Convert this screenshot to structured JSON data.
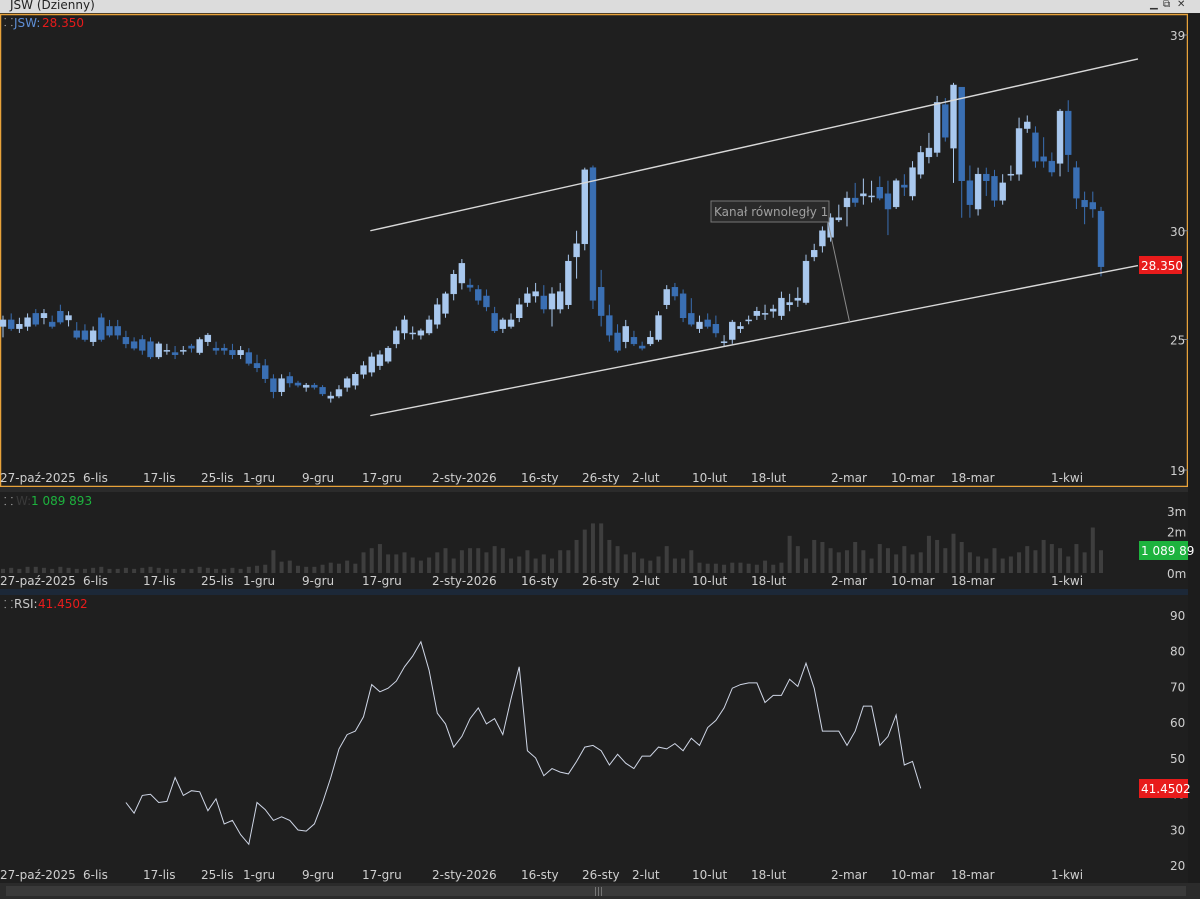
{
  "window": {
    "title": "JSW (Dzienny)",
    "min_icon": "minimize-icon",
    "restore_icon": "restore-icon",
    "close_icon": "close-icon"
  },
  "colors": {
    "background": "#1f1f1f",
    "border_accent": "#e8a23a",
    "bull": "#a9c8ee",
    "bear": "#3a6fb3",
    "price_badge": "#e81b1b",
    "volume_badge": "#1db33e",
    "line": "#d8d8d8",
    "volume_bar": "#3e3e3e"
  },
  "panels": {
    "price": {
      "label": "JSW:",
      "value": "28.350",
      "badge": "28.350",
      "yaxis_ticks": [
        "39",
        "30",
        "25",
        "19"
      ]
    },
    "volume": {
      "label": "W:",
      "value": "1 089 893",
      "badge": "1 089 89",
      "yaxis_ticks": [
        "3m",
        "2m",
        "1m",
        "0m"
      ]
    },
    "rsi": {
      "label": "RSI:",
      "value": "41.4502",
      "badge": "41.4502",
      "yaxis_ticks": [
        "90",
        "80",
        "70",
        "60",
        "50",
        "40",
        "30",
        "20"
      ]
    }
  },
  "annotation": {
    "text": "Kanał równoległy 1"
  },
  "x_labels": [
    "27-paź-2025",
    "6-lis",
    "17-lis",
    "25-lis",
    "1-gru",
    "9-gru",
    "17-gru",
    "2-sty-2026",
    "16-sty",
    "26-sty",
    "2-lut",
    "10-lut",
    "18-lut",
    "2-mar",
    "10-mar",
    "18-mar",
    "1-kwi"
  ],
  "chart_data": [
    {
      "type": "candlestick",
      "series_name": "JSW",
      "ylim": [
        19,
        40
      ],
      "ohlc": [
        [
          25.6,
          26.1,
          25.1,
          25.9
        ],
        [
          25.9,
          26.2,
          25.4,
          25.5
        ],
        [
          25.5,
          26.0,
          25.3,
          25.7
        ],
        [
          25.6,
          26.2,
          25.4,
          26.0
        ],
        [
          26.2,
          26.4,
          25.6,
          25.7
        ],
        [
          26.0,
          26.4,
          25.7,
          26.2
        ],
        [
          25.8,
          26.1,
          25.5,
          25.6
        ],
        [
          26.3,
          26.6,
          25.7,
          25.8
        ],
        [
          25.9,
          26.3,
          25.6,
          26.1
        ],
        [
          25.4,
          25.8,
          25.0,
          25.1
        ],
        [
          25.4,
          25.7,
          24.9,
          25.0
        ],
        [
          24.9,
          25.6,
          24.7,
          25.4
        ],
        [
          26.0,
          26.2,
          24.9,
          25.0
        ],
        [
          25.6,
          25.9,
          25.1,
          25.2
        ],
        [
          25.6,
          25.9,
          25.0,
          25.2
        ],
        [
          25.1,
          25.4,
          24.6,
          24.8
        ],
        [
          24.9,
          25.1,
          24.5,
          24.6
        ],
        [
          25.0,
          25.2,
          24.3,
          24.5
        ],
        [
          24.9,
          25.1,
          24.1,
          24.2
        ],
        [
          24.2,
          24.9,
          24.1,
          24.8
        ],
        [
          24.5,
          24.8,
          24.3,
          24.5
        ],
        [
          24.4,
          24.7,
          24.1,
          24.3
        ],
        [
          24.5,
          24.7,
          24.3,
          24.5
        ],
        [
          24.7,
          24.8,
          24.4,
          24.6
        ],
        [
          24.4,
          25.1,
          24.3,
          25.0
        ],
        [
          24.9,
          25.3,
          24.7,
          25.2
        ],
        [
          24.6,
          24.9,
          24.3,
          24.5
        ],
        [
          24.6,
          24.8,
          24.3,
          24.5
        ],
        [
          24.5,
          24.8,
          24.1,
          24.3
        ],
        [
          24.3,
          24.7,
          24.1,
          24.5
        ],
        [
          24.4,
          24.6,
          23.8,
          23.9
        ],
        [
          23.9,
          24.3,
          23.5,
          23.7
        ],
        [
          23.8,
          24.1,
          23.0,
          23.2
        ],
        [
          23.2,
          23.4,
          22.3,
          22.6
        ],
        [
          22.6,
          23.4,
          22.4,
          23.2
        ],
        [
          23.3,
          23.5,
          22.8,
          23.0
        ],
        [
          23.0,
          23.1,
          22.8,
          22.9
        ],
        [
          22.8,
          23.0,
          22.6,
          22.9
        ],
        [
          22.9,
          23.0,
          22.7,
          22.8
        ],
        [
          22.8,
          22.9,
          22.4,
          22.5
        ],
        [
          22.3,
          22.6,
          22.1,
          22.4
        ],
        [
          22.4,
          22.9,
          22.3,
          22.7
        ],
        [
          22.8,
          23.3,
          22.6,
          23.2
        ],
        [
          22.9,
          23.5,
          22.7,
          23.4
        ],
        [
          23.4,
          24.0,
          23.2,
          23.8
        ],
        [
          23.5,
          24.4,
          23.3,
          24.2
        ],
        [
          23.8,
          24.5,
          23.6,
          24.3
        ],
        [
          24.0,
          24.7,
          23.9,
          24.6
        ],
        [
          24.8,
          25.6,
          24.6,
          25.4
        ],
        [
          25.3,
          26.1,
          25.0,
          25.9
        ],
        [
          25.3,
          25.6,
          25.0,
          25.3
        ],
        [
          25.2,
          25.5,
          25.0,
          25.4
        ],
        [
          25.3,
          26.1,
          25.2,
          25.9
        ],
        [
          25.7,
          26.9,
          25.5,
          26.6
        ],
        [
          26.2,
          27.2,
          26.0,
          27.1
        ],
        [
          27.1,
          28.2,
          26.8,
          28.0
        ],
        [
          27.6,
          28.7,
          27.3,
          28.5
        ],
        [
          27.5,
          27.8,
          27.2,
          27.4
        ],
        [
          27.3,
          27.5,
          26.6,
          26.8
        ],
        [
          27.0,
          27.3,
          26.3,
          26.5
        ],
        [
          26.2,
          26.5,
          25.3,
          25.4
        ],
        [
          25.5,
          26.0,
          25.3,
          25.9
        ],
        [
          25.6,
          26.2,
          25.5,
          25.9
        ],
        [
          26.0,
          26.9,
          25.8,
          26.6
        ],
        [
          26.7,
          27.4,
          26.5,
          27.1
        ],
        [
          27.0,
          27.6,
          26.7,
          27.2
        ],
        [
          27.0,
          27.5,
          26.2,
          26.4
        ],
        [
          26.4,
          27.4,
          25.6,
          27.1
        ],
        [
          26.4,
          27.6,
          26.2,
          27.2
        ],
        [
          26.6,
          28.9,
          26.4,
          28.6
        ],
        [
          28.8,
          30.0,
          27.8,
          29.4
        ],
        [
          29.4,
          32.9,
          29.1,
          32.8
        ],
        [
          32.9,
          33.0,
          26.4,
          26.8
        ],
        [
          27.4,
          28.2,
          25.6,
          26.1
        ],
        [
          26.1,
          26.6,
          24.9,
          25.2
        ],
        [
          25.3,
          25.7,
          24.4,
          24.5
        ],
        [
          24.9,
          25.9,
          24.6,
          25.6
        ],
        [
          25.1,
          25.4,
          24.7,
          24.8
        ],
        [
          24.7,
          24.9,
          24.5,
          24.6
        ],
        [
          24.8,
          25.4,
          24.7,
          25.1
        ],
        [
          25.0,
          26.3,
          24.9,
          26.1
        ],
        [
          26.6,
          27.5,
          26.4,
          27.3
        ],
        [
          27.4,
          27.6,
          26.8,
          27.0
        ],
        [
          27.1,
          27.3,
          25.8,
          26.0
        ],
        [
          26.2,
          26.9,
          25.6,
          25.7
        ],
        [
          25.5,
          26.1,
          25.3,
          25.8
        ],
        [
          25.9,
          26.2,
          25.5,
          25.6
        ],
        [
          25.7,
          26.1,
          25.1,
          25.3
        ],
        [
          24.9,
          25.2,
          24.7,
          24.9
        ],
        [
          25.0,
          25.9,
          24.8,
          25.8
        ],
        [
          25.5,
          25.8,
          25.3,
          25.6
        ],
        [
          25.9,
          26.1,
          25.7,
          25.9
        ],
        [
          26.1,
          26.5,
          25.9,
          26.3
        ],
        [
          26.2,
          26.6,
          25.9,
          26.2
        ],
        [
          26.3,
          26.6,
          26.0,
          26.4
        ],
        [
          26.1,
          27.2,
          25.9,
          26.9
        ],
        [
          26.6,
          27.1,
          26.3,
          26.7
        ],
        [
          26.8,
          27.4,
          26.5,
          26.9
        ],
        [
          26.7,
          28.9,
          26.6,
          28.6
        ],
        [
          28.8,
          29.4,
          28.6,
          29.1
        ],
        [
          29.3,
          30.2,
          29.0,
          30.0
        ],
        [
          29.7,
          30.8,
          29.5,
          30.6
        ],
        [
          30.5,
          31.2,
          30.4,
          30.6
        ],
        [
          31.1,
          31.8,
          30.2,
          31.5
        ],
        [
          31.5,
          32.2,
          31.1,
          31.3
        ],
        [
          31.6,
          32.4,
          31.2,
          31.7
        ],
        [
          31.6,
          32.3,
          31.3,
          31.6
        ],
        [
          32.0,
          32.5,
          31.4,
          31.5
        ],
        [
          31.7,
          32.3,
          29.8,
          31.0
        ],
        [
          31.1,
          32.4,
          31.0,
          32.3
        ],
        [
          32.1,
          32.6,
          31.6,
          32.0
        ],
        [
          31.6,
          33.2,
          31.4,
          32.9
        ],
        [
          32.6,
          33.9,
          32.4,
          33.6
        ],
        [
          33.4,
          34.5,
          33.1,
          33.8
        ],
        [
          33.6,
          36.2,
          33.4,
          35.9
        ],
        [
          35.8,
          36.1,
          34.1,
          34.3
        ],
        [
          33.8,
          36.8,
          32.2,
          36.7
        ],
        [
          36.6,
          36.6,
          30.6,
          32.3
        ],
        [
          32.3,
          33.0,
          30.6,
          31.2
        ],
        [
          31.0,
          32.9,
          30.7,
          32.6
        ],
        [
          32.6,
          32.9,
          31.6,
          32.3
        ],
        [
          32.5,
          32.8,
          31.1,
          31.4
        ],
        [
          31.4,
          32.6,
          31.2,
          32.2
        ],
        [
          32.6,
          33.0,
          32.3,
          32.6
        ],
        [
          32.6,
          35.2,
          32.3,
          34.7
        ],
        [
          34.7,
          35.3,
          34.5,
          35.0
        ],
        [
          34.5,
          34.8,
          32.9,
          33.2
        ],
        [
          33.4,
          34.3,
          32.9,
          33.2
        ],
        [
          33.2,
          33.6,
          32.5,
          32.7
        ],
        [
          33.1,
          35.6,
          32.5,
          35.5
        ],
        [
          35.5,
          36.0,
          32.7,
          33.5
        ],
        [
          32.9,
          33.2,
          31.0,
          31.5
        ],
        [
          31.4,
          31.8,
          30.3,
          31.1
        ],
        [
          31.3,
          31.8,
          30.6,
          31.0
        ],
        [
          30.9,
          31.1,
          27.9,
          28.35
        ]
      ],
      "lines": [
        {
          "name": "channel-upper",
          "x": [
            0.3086,
            0.9483
          ],
          "y": [
            30.0,
            37.9
          ]
        },
        {
          "name": "channel-lower",
          "x": [
            0.3086,
            0.9483
          ],
          "y": [
            21.5,
            28.4
          ]
        },
        {
          "name": "annotation-leader",
          "x": [
            0.688,
            0.708
          ],
          "y": [
            30.9,
            25.8
          ]
        }
      ]
    },
    {
      "type": "bar",
      "series_name": "W",
      "ylim": [
        0,
        3.0
      ],
      "unit": "m",
      "values": [
        0.2,
        0.25,
        0.2,
        0.3,
        0.3,
        0.25,
        0.2,
        0.3,
        0.25,
        0.2,
        0.2,
        0.25,
        0.3,
        0.2,
        0.2,
        0.25,
        0.2,
        0.25,
        0.3,
        0.25,
        0.2,
        0.2,
        0.2,
        0.2,
        0.3,
        0.25,
        0.2,
        0.2,
        0.25,
        0.2,
        0.3,
        0.35,
        0.4,
        1.1,
        0.55,
        0.6,
        0.35,
        0.3,
        0.3,
        0.4,
        0.5,
        0.45,
        0.6,
        0.45,
        1.0,
        1.2,
        1.4,
        0.9,
        0.9,
        1.0,
        0.75,
        0.6,
        0.75,
        1.0,
        1.2,
        0.7,
        1.1,
        1.2,
        1.2,
        1.0,
        1.3,
        1.2,
        0.7,
        0.8,
        1.1,
        0.7,
        0.9,
        0.7,
        1.1,
        1.1,
        1.6,
        2.1,
        2.4,
        2.4,
        1.6,
        1.3,
        0.9,
        1.0,
        0.7,
        0.6,
        0.8,
        1.3,
        0.7,
        0.7,
        1.1,
        0.5,
        0.45,
        0.45,
        0.4,
        0.5,
        0.5,
        0.45,
        0.4,
        0.6,
        0.4,
        0.5,
        1.8,
        1.3,
        0.7,
        1.6,
        1.5,
        1.2,
        1.0,
        1.1,
        1.5,
        1.1,
        0.7,
        1.4,
        1.2,
        0.9,
        1.3,
        0.9,
        1.0,
        1.8,
        1.6,
        1.2,
        1.9,
        1.5,
        1.0,
        0.8,
        0.7,
        1.2,
        0.7,
        0.8,
        1.0,
        1.3,
        1.1,
        1.6,
        1.4,
        1.2,
        0.8,
        1.4,
        1.0,
        2.2,
        1.1
      ]
    },
    {
      "type": "line",
      "series_name": "RSI",
      "ylim": [
        17,
        95
      ],
      "start_index": 15,
      "values": [
        37.5,
        34.5,
        39.5,
        39.8,
        37.5,
        37.8,
        44.5,
        39.5,
        40.8,
        40.5,
        35.2,
        38.5,
        31.5,
        32.5,
        28.5,
        25.8,
        37.5,
        35.5,
        32.5,
        33.5,
        32.5,
        29.8,
        29.5,
        31.5,
        37.5,
        44.5,
        52.5,
        56.5,
        57.5,
        61.5,
        70.5,
        68.5,
        69.5,
        71.5,
        75.5,
        78.5,
        82.5,
        74.5,
        62.5,
        59.5,
        53.0,
        56.0,
        61.0,
        64.0,
        59.5,
        61.0,
        56.5,
        66.5,
        75.5,
        52.0,
        50.0,
        45.0,
        47.0,
        46.0,
        45.5,
        49.0,
        53.0,
        53.5,
        52.0,
        48.0,
        51.0,
        48.5,
        47.0,
        50.5,
        50.5,
        53.0,
        52.5,
        54.0,
        52.0,
        55.5,
        53.5,
        58.5,
        60.5,
        64.0,
        69.5,
        70.5,
        71.0,
        71.0,
        65.5,
        67.5,
        67.5,
        72.0,
        70.0,
        76.5,
        69.5,
        57.5,
        57.5,
        57.5,
        53.5,
        57.5,
        64.5,
        64.5,
        53.5,
        56.0,
        62.0,
        48.0,
        49.0,
        41.45
      ]
    }
  ]
}
